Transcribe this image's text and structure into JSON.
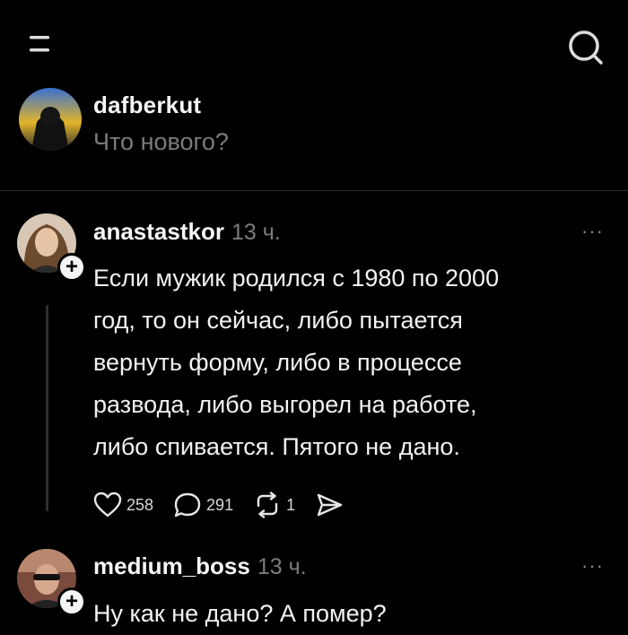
{
  "header": {
    "menu_icon": "menu-icon",
    "search_icon": "search-icon"
  },
  "composer": {
    "username": "dafberkut",
    "prompt": "Что нового?"
  },
  "posts": [
    {
      "username": "anastastkor",
      "time": "13 ч.",
      "more": "···",
      "text_lines": [
        "Если мужик родился с 1980 по 2000",
        "год, то он сейчас, либо пытается",
        "вернуть форму, либо в процессе",
        "развода, либо выгорел на работе,",
        "либо спивается. Пятого не дано."
      ],
      "likes": "258",
      "comments": "291",
      "reposts": "1",
      "icons": [
        "heart-icon",
        "comment-icon",
        "repost-icon",
        "share-icon"
      ]
    },
    {
      "username": "medium_boss",
      "time": "13 ч.",
      "more": "···",
      "text": "Ну как не дано? А помер?"
    }
  ],
  "colors": {
    "background": "#000000",
    "text_primary": "#f3f3f3",
    "text_secondary": "#7c7c7c",
    "divider": "#262626"
  }
}
